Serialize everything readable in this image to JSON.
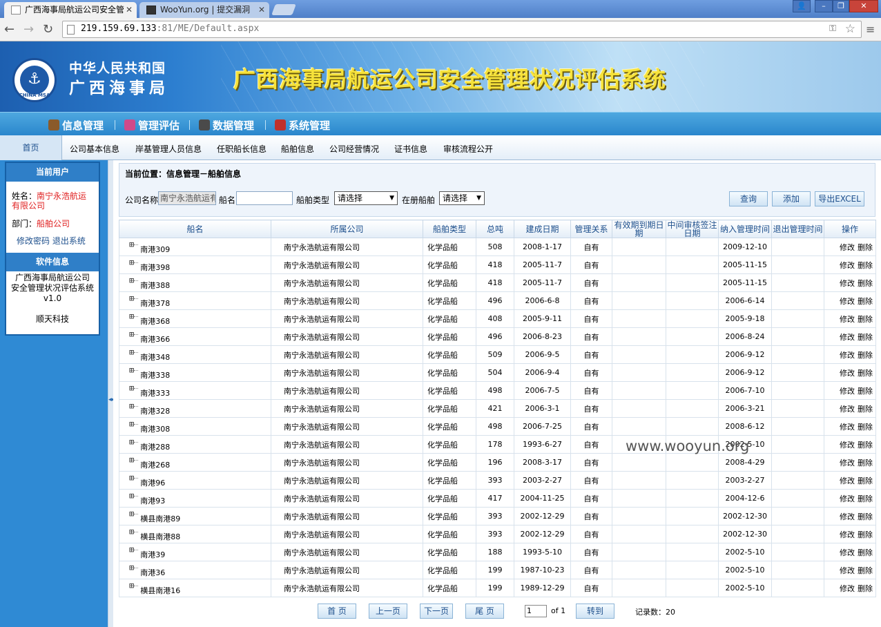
{
  "browser": {
    "tabs": [
      {
        "title": "广西海事局航运公司安全管",
        "active": true
      },
      {
        "title": "WooYun.org | 提交漏洞",
        "active": false
      }
    ],
    "url_host": "219.159.69.133",
    "url_rest": ":81/ME/Default.aspx"
  },
  "banner": {
    "org_line1": "中华人民共和国",
    "org_line2": "广西海事局",
    "logo_text": "CHINA MSA",
    "system_title": "广西海事局航运公司安全管理状况评估系统"
  },
  "main_menu": [
    {
      "label": "信息管理",
      "icon_color": "#8a5a2a"
    },
    {
      "label": "管理评估",
      "icon_color": "#d04a8a"
    },
    {
      "label": "数据管理",
      "icon_color": "#4a4a4a"
    },
    {
      "label": "系统管理",
      "icon_color": "#c0302a"
    }
  ],
  "sub_menu": {
    "home": "首页",
    "items": [
      "公司基本信息",
      "岸基管理人员信息",
      "任职船长信息",
      "船舶信息",
      "公司经营情况",
      "证书信息",
      "审核流程公开"
    ]
  },
  "sidebar": {
    "user_header": "当前用户",
    "name_label": "姓名：",
    "name_value_1": "南宁永浩航运",
    "name_value_2": "有限公司",
    "dept_label": "部门：",
    "dept_value": "船舶公司",
    "change_password": "修改密码",
    "logout": "退出系统",
    "software_header": "软件信息",
    "software_line1": "广西海事局航运公司",
    "software_line2": "安全管理状况评估系统",
    "version": "v1.0",
    "vendor": "顺天科技"
  },
  "search": {
    "breadcrumb": "当前位置：信息管理－船舶信息",
    "company_label": "公司名称",
    "company_value": "南宁永浩航运有",
    "shipname_label": "船名",
    "shipname_value": "",
    "shiptype_label": "船舶类型",
    "shiptype_value": "请选择",
    "registered_label": "在册船舶",
    "registered_value": "请选择",
    "query_btn": "查询",
    "add_btn": "添加",
    "export_btn": "导出EXCEL"
  },
  "grid": {
    "headers": [
      "船名",
      "所属公司",
      "船舶类型",
      "总吨",
      "建成日期",
      "管理关系",
      "有效期到期日期",
      "中间审核签注日期",
      "纳入管理时间",
      "退出管理时间",
      "操作"
    ],
    "edit_label": "修改",
    "delete_label": "删除",
    "rows": [
      {
        "name": "南港309",
        "company": "南宁永浩航运有限公司",
        "type": "化学品船",
        "tonnage": "508",
        "built": "2008-1-17",
        "relation": "自有",
        "expiry": "",
        "audit": "",
        "in_date": "2009-12-10",
        "out_date": ""
      },
      {
        "name": "南港398",
        "company": "南宁永浩航运有限公司",
        "type": "化学品船",
        "tonnage": "418",
        "built": "2005-11-7",
        "relation": "自有",
        "expiry": "",
        "audit": "",
        "in_date": "2005-11-15",
        "out_date": ""
      },
      {
        "name": "南港388",
        "company": "南宁永浩航运有限公司",
        "type": "化学品船",
        "tonnage": "418",
        "built": "2005-11-7",
        "relation": "自有",
        "expiry": "",
        "audit": "",
        "in_date": "2005-11-15",
        "out_date": ""
      },
      {
        "name": "南港378",
        "company": "南宁永浩航运有限公司",
        "type": "化学品船",
        "tonnage": "496",
        "built": "2006-6-8",
        "relation": "自有",
        "expiry": "",
        "audit": "",
        "in_date": "2006-6-14",
        "out_date": ""
      },
      {
        "name": "南港368",
        "company": "南宁永浩航运有限公司",
        "type": "化学品船",
        "tonnage": "408",
        "built": "2005-9-11",
        "relation": "自有",
        "expiry": "",
        "audit": "",
        "in_date": "2005-9-18",
        "out_date": ""
      },
      {
        "name": "南港366",
        "company": "南宁永浩航运有限公司",
        "type": "化学品船",
        "tonnage": "496",
        "built": "2006-8-23",
        "relation": "自有",
        "expiry": "",
        "audit": "",
        "in_date": "2006-8-24",
        "out_date": ""
      },
      {
        "name": "南港348",
        "company": "南宁永浩航运有限公司",
        "type": "化学品船",
        "tonnage": "509",
        "built": "2006-9-5",
        "relation": "自有",
        "expiry": "",
        "audit": "",
        "in_date": "2006-9-12",
        "out_date": ""
      },
      {
        "name": "南港338",
        "company": "南宁永浩航运有限公司",
        "type": "化学品船",
        "tonnage": "504",
        "built": "2006-9-4",
        "relation": "自有",
        "expiry": "",
        "audit": "",
        "in_date": "2006-9-12",
        "out_date": ""
      },
      {
        "name": "南港333",
        "company": "南宁永浩航运有限公司",
        "type": "化学品船",
        "tonnage": "498",
        "built": "2006-7-5",
        "relation": "自有",
        "expiry": "",
        "audit": "",
        "in_date": "2006-7-10",
        "out_date": ""
      },
      {
        "name": "南港328",
        "company": "南宁永浩航运有限公司",
        "type": "化学品船",
        "tonnage": "421",
        "built": "2006-3-1",
        "relation": "自有",
        "expiry": "",
        "audit": "",
        "in_date": "2006-3-21",
        "out_date": ""
      },
      {
        "name": "南港308",
        "company": "南宁永浩航运有限公司",
        "type": "化学品船",
        "tonnage": "498",
        "built": "2006-7-25",
        "relation": "自有",
        "expiry": "",
        "audit": "",
        "in_date": "2008-6-12",
        "out_date": ""
      },
      {
        "name": "南港288",
        "company": "南宁永浩航运有限公司",
        "type": "化学品船",
        "tonnage": "178",
        "built": "1993-6-27",
        "relation": "自有",
        "expiry": "",
        "audit": "",
        "in_date": "2002-5-10",
        "out_date": ""
      },
      {
        "name": "南港268",
        "company": "南宁永浩航运有限公司",
        "type": "化学品船",
        "tonnage": "196",
        "built": "2008-3-17",
        "relation": "自有",
        "expiry": "",
        "audit": "",
        "in_date": "2008-4-29",
        "out_date": ""
      },
      {
        "name": "南港96",
        "company": "南宁永浩航运有限公司",
        "type": "化学品船",
        "tonnage": "393",
        "built": "2003-2-27",
        "relation": "自有",
        "expiry": "",
        "audit": "",
        "in_date": "2003-2-27",
        "out_date": ""
      },
      {
        "name": "南港93",
        "company": "南宁永浩航运有限公司",
        "type": "化学品船",
        "tonnage": "417",
        "built": "2004-11-25",
        "relation": "自有",
        "expiry": "",
        "audit": "",
        "in_date": "2004-12-6",
        "out_date": ""
      },
      {
        "name": "横县南港89",
        "company": "南宁永浩航运有限公司",
        "type": "化学品船",
        "tonnage": "393",
        "built": "2002-12-29",
        "relation": "自有",
        "expiry": "",
        "audit": "",
        "in_date": "2002-12-30",
        "out_date": ""
      },
      {
        "name": "横县南港88",
        "company": "南宁永浩航运有限公司",
        "type": "化学品船",
        "tonnage": "393",
        "built": "2002-12-29",
        "relation": "自有",
        "expiry": "",
        "audit": "",
        "in_date": "2002-12-30",
        "out_date": ""
      },
      {
        "name": "南港39",
        "company": "南宁永浩航运有限公司",
        "type": "化学品船",
        "tonnage": "188",
        "built": "1993-5-10",
        "relation": "自有",
        "expiry": "",
        "audit": "",
        "in_date": "2002-5-10",
        "out_date": ""
      },
      {
        "name": "南港36",
        "company": "南宁永浩航运有限公司",
        "type": "化学品船",
        "tonnage": "199",
        "built": "1987-10-23",
        "relation": "自有",
        "expiry": "",
        "audit": "",
        "in_date": "2002-5-10",
        "out_date": ""
      },
      {
        "name": "横县南港16",
        "company": "南宁永浩航运有限公司",
        "type": "化学品船",
        "tonnage": "199",
        "built": "1989-12-29",
        "relation": "自有",
        "expiry": "",
        "audit": "",
        "in_date": "2002-5-10",
        "out_date": ""
      }
    ]
  },
  "pager": {
    "first": "首 页",
    "prev": "上一页",
    "next": "下一页",
    "last": "尾 页",
    "page_value": "1",
    "of_text": "of 1",
    "go": "转到",
    "records_text": "记录数：20"
  },
  "watermark": "www.wooyun.org"
}
